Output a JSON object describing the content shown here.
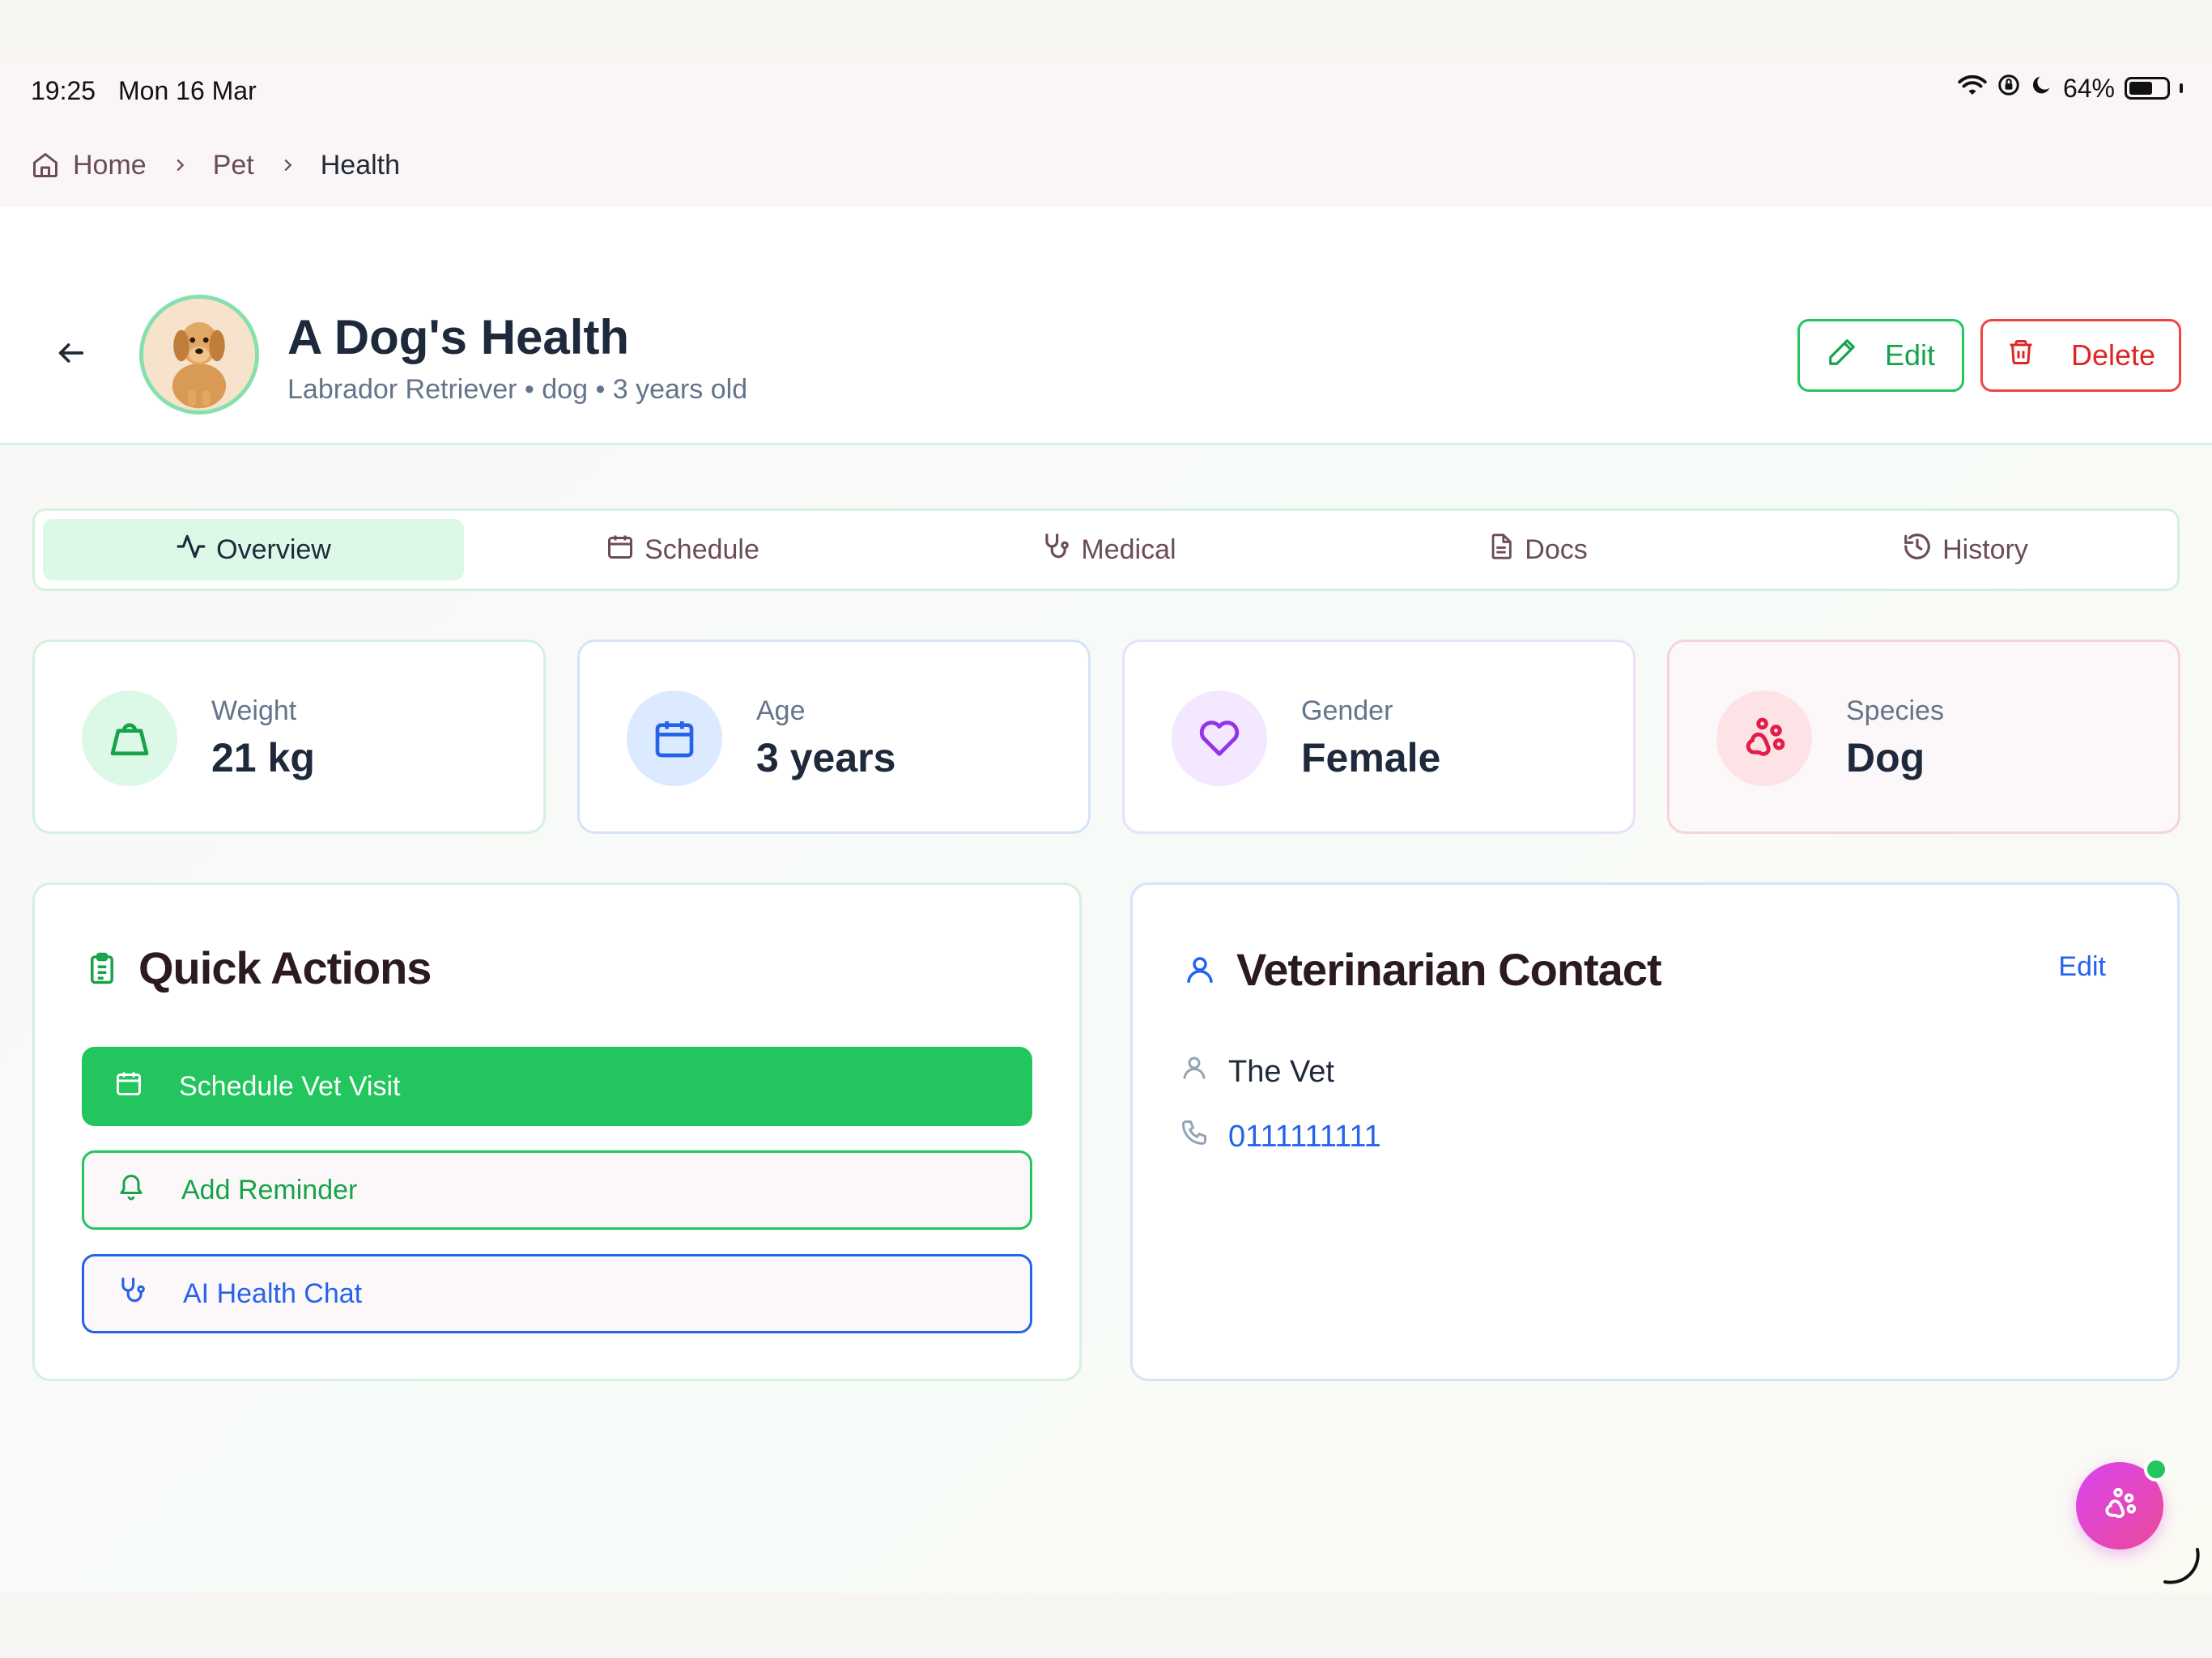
{
  "status_bar": {
    "time": "19:25",
    "date": "Mon 16 Mar",
    "battery": "64%",
    "battery_level": 0.64
  },
  "breadcrumb": {
    "items": [
      "Home",
      "Pet",
      "Health"
    ]
  },
  "header": {
    "title": "A Dog's Health",
    "subtitle": "Labrador Retriever • dog • 3 years old",
    "edit_label": "Edit",
    "delete_label": "Delete"
  },
  "tabs": [
    {
      "label": "Overview",
      "icon": "activity-icon",
      "active": true
    },
    {
      "label": "Schedule",
      "icon": "calendar-icon",
      "active": false
    },
    {
      "label": "Medical",
      "icon": "stethoscope-icon",
      "active": false
    },
    {
      "label": "Docs",
      "icon": "document-icon",
      "active": false
    },
    {
      "label": "History",
      "icon": "history-icon",
      "active": false
    }
  ],
  "stats": [
    {
      "label": "Weight",
      "value": "21 kg",
      "icon": "weight-icon",
      "color": "#16a34a",
      "bg": "#dcf8e6"
    },
    {
      "label": "Age",
      "value": "3 years",
      "icon": "calendar-icon",
      "color": "#2563eb",
      "bg": "#dbeafe"
    },
    {
      "label": "Gender",
      "value": "Female",
      "icon": "heart-icon",
      "color": "#9333ea",
      "bg": "#f3e8ff"
    },
    {
      "label": "Species",
      "value": "Dog",
      "icon": "paw-icon",
      "color": "#e11d48",
      "bg": "#fde2e6"
    }
  ],
  "quick_actions": {
    "title": "Quick Actions",
    "buttons": [
      {
        "label": "Schedule Vet Visit",
        "icon": "calendar-icon"
      },
      {
        "label": "Add Reminder",
        "icon": "bell-icon"
      },
      {
        "label": "AI Health Chat",
        "icon": "stethoscope-icon"
      }
    ]
  },
  "vet_contact": {
    "title": "Veterinarian Contact",
    "edit_label": "Edit",
    "name": "The Vet",
    "phone": "0111111111"
  },
  "colors": {
    "primary_green": "#22c55e",
    "danger_red": "#ef4444",
    "link_blue": "#2563eb",
    "fab_gradient_start": "#d946ef",
    "fab_gradient_end": "#ec4899"
  }
}
